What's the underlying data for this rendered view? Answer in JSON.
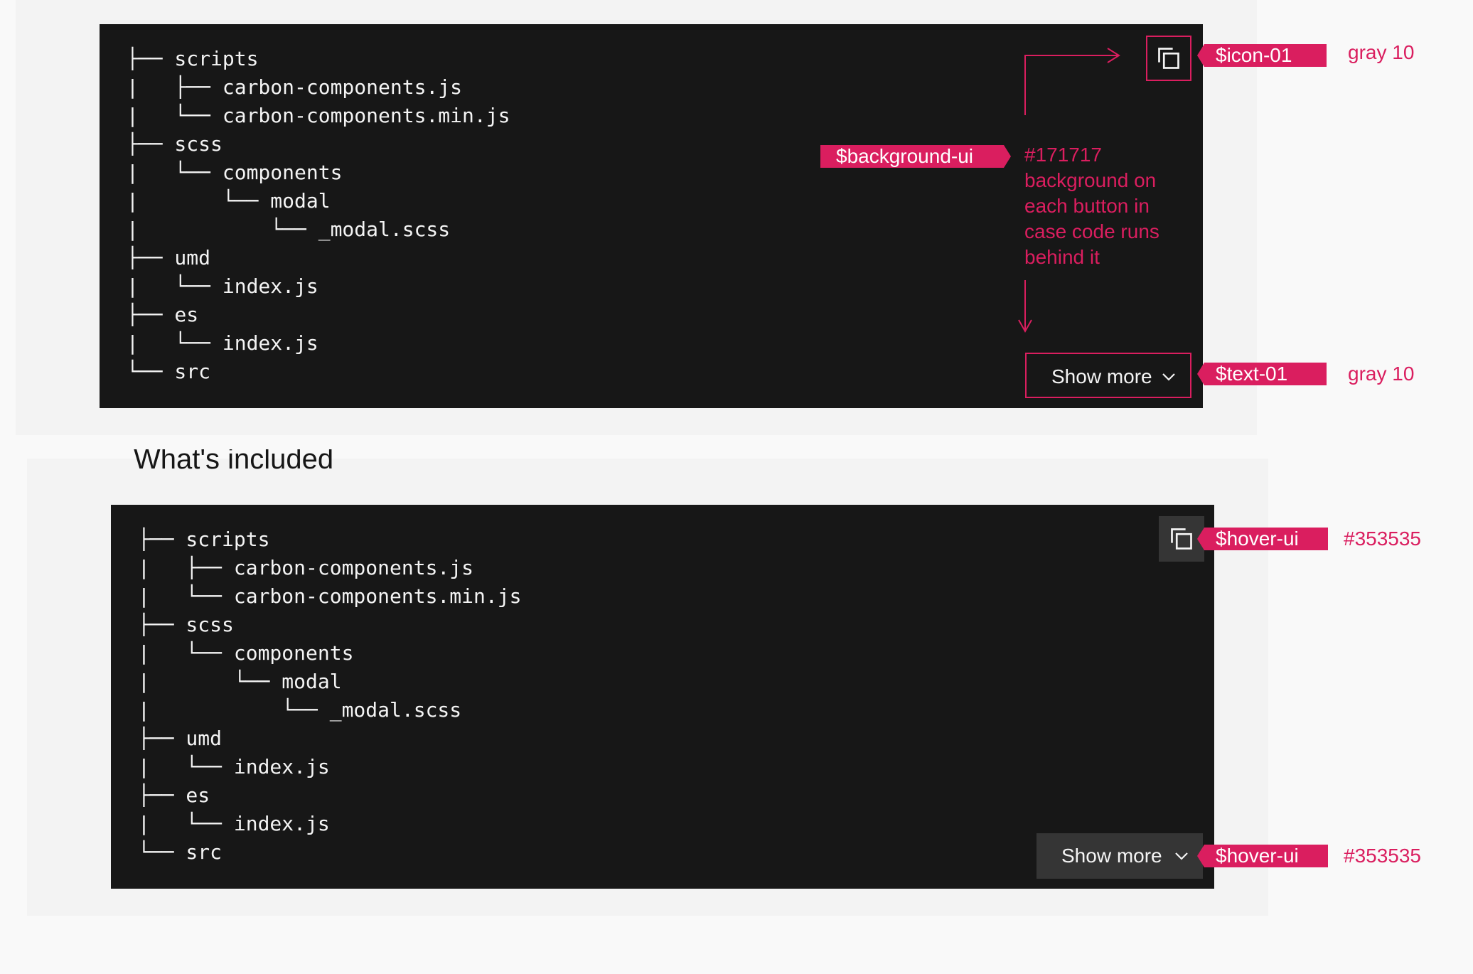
{
  "code_lines": [
    "├── scripts",
    "|   ├── carbon-components.js",
    "|   └── carbon-components.min.js",
    "├── scss",
    "|   └── components",
    "|       └── modal",
    "|           └── _modal.scss",
    "├── umd",
    "|   └── index.js",
    "├── es",
    "|   └── index.js",
    "└── src"
  ],
  "section_title": "What's included",
  "show_more_label": "Show more",
  "annotations": {
    "icon_token": "$icon-01",
    "icon_value": "gray 10",
    "background_token": "$background-ui",
    "background_note": [
      "#171717",
      "background on",
      "each button in",
      "case code runs",
      "behind it"
    ],
    "text_token": "$text-01",
    "text_value": "gray 10",
    "hover_token_copy": "$hover-ui",
    "hover_value_copy": "#353535",
    "hover_token_show_more": "$hover-ui",
    "hover_value_show_more": "#353535"
  },
  "colors": {
    "accent": "#da1e5f",
    "code_background": "#171717",
    "hover_ui": "#353535",
    "text_on_dark": "#f4f4f4",
    "panel_background": "#f3f3f3",
    "page_background": "#f9f9f9"
  },
  "icons": {
    "copy": "copy-icon",
    "show_more": "chevron-down-icon"
  }
}
